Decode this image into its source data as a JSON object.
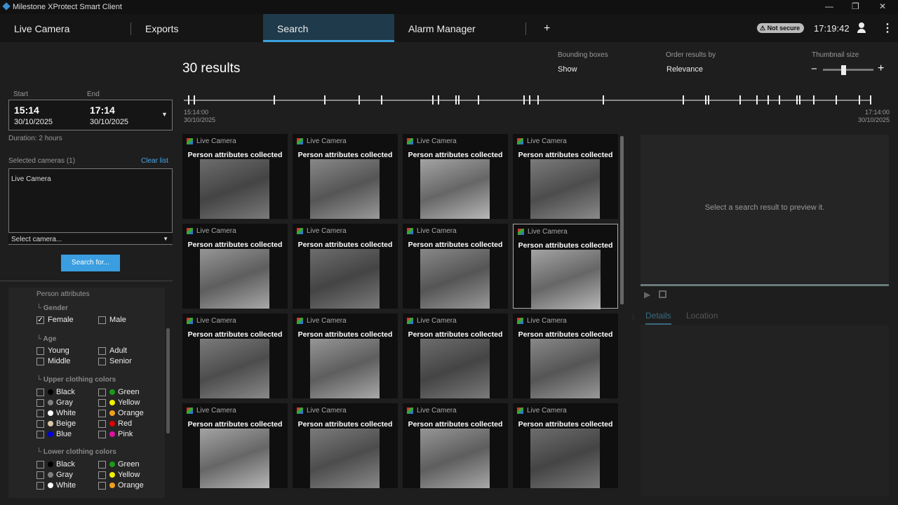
{
  "window": {
    "title": "Milestone XProtect Smart Client",
    "min": "—",
    "max": "❐",
    "close": "✕"
  },
  "nav": {
    "tabs": [
      "Live Camera",
      "Exports",
      "Search",
      "Alarm Manager"
    ],
    "add": "+",
    "security": "⚠ Not secure",
    "clock": "17:19:42",
    "user_icon": "user-icon",
    "more": "⋮"
  },
  "filters": {
    "start_label": "Start",
    "end_label": "End",
    "start_time": "15:14",
    "start_date": "30/10/2025",
    "end_time": "17:14",
    "end_date": "30/10/2025",
    "duration": "Duration: 2 hours",
    "selected_cameras": "Selected cameras (1)",
    "clear_list": "Clear list",
    "cameras": [
      "Live Camera"
    ],
    "select_camera": "Select camera...",
    "search_for": "Search for...",
    "section": "Person attributes",
    "gender": {
      "label": "Gender",
      "options": [
        {
          "label": "Female",
          "checked": true
        },
        {
          "label": "Male",
          "checked": false
        }
      ]
    },
    "age": {
      "label": "Age",
      "options": [
        "Young",
        "Adult",
        "Middle",
        "Senior"
      ]
    },
    "upper": {
      "label": "Upper clothing colors",
      "colors": [
        {
          "name": "Black",
          "hex": "#000000"
        },
        {
          "name": "Green",
          "hex": "#1a9a1a"
        },
        {
          "name": "Gray",
          "hex": "#808080"
        },
        {
          "name": "Yellow",
          "hex": "#f0f000"
        },
        {
          "name": "White",
          "hex": "#ffffff"
        },
        {
          "name": "Orange",
          "hex": "#f0a020"
        },
        {
          "name": "Beige",
          "hex": "#d8c8a8"
        },
        {
          "name": "Red",
          "hex": "#e00000"
        },
        {
          "name": "Blue",
          "hex": "#0000e0"
        },
        {
          "name": "Pink",
          "hex": "#e010a0"
        }
      ]
    },
    "lower": {
      "label": "Lower clothing colors",
      "colors": [
        {
          "name": "Black",
          "hex": "#000000"
        },
        {
          "name": "Green",
          "hex": "#1a9a1a"
        },
        {
          "name": "Gray",
          "hex": "#808080"
        },
        {
          "name": "Yellow",
          "hex": "#f0f000"
        },
        {
          "name": "White",
          "hex": "#ffffff"
        },
        {
          "name": "Orange",
          "hex": "#f0a020"
        }
      ]
    }
  },
  "results": {
    "count": "30 results",
    "bbox_label": "Bounding boxes",
    "bbox_value": "Show",
    "order_label": "Order results by",
    "order_value": "Relevance",
    "thumb_label": "Thumbnail size",
    "thumb_minus": "−",
    "thumb_plus": "+",
    "thumb_level": 0.4,
    "timeline": {
      "start_time": "15:14:00",
      "start_date": "30/10/2025",
      "end_time": "17:14:00",
      "end_date": "30/10/2025",
      "span_minutes": 120,
      "marks_minutes": [
        0,
        1,
        15,
        24,
        30,
        34,
        43,
        44,
        47,
        47.5,
        51,
        59,
        60,
        61.5,
        73,
        87,
        91,
        91.5,
        97,
        100,
        102,
        104,
        107,
        107.5,
        110,
        114,
        118,
        120
      ]
    },
    "camera": "Live Camera",
    "caption": "Person attributes collected",
    "visible_count": 16,
    "selected_index": 7
  },
  "preview": {
    "placeholder": "Select a search result to preview it.",
    "tabs": [
      "Details",
      "Location"
    ]
  }
}
